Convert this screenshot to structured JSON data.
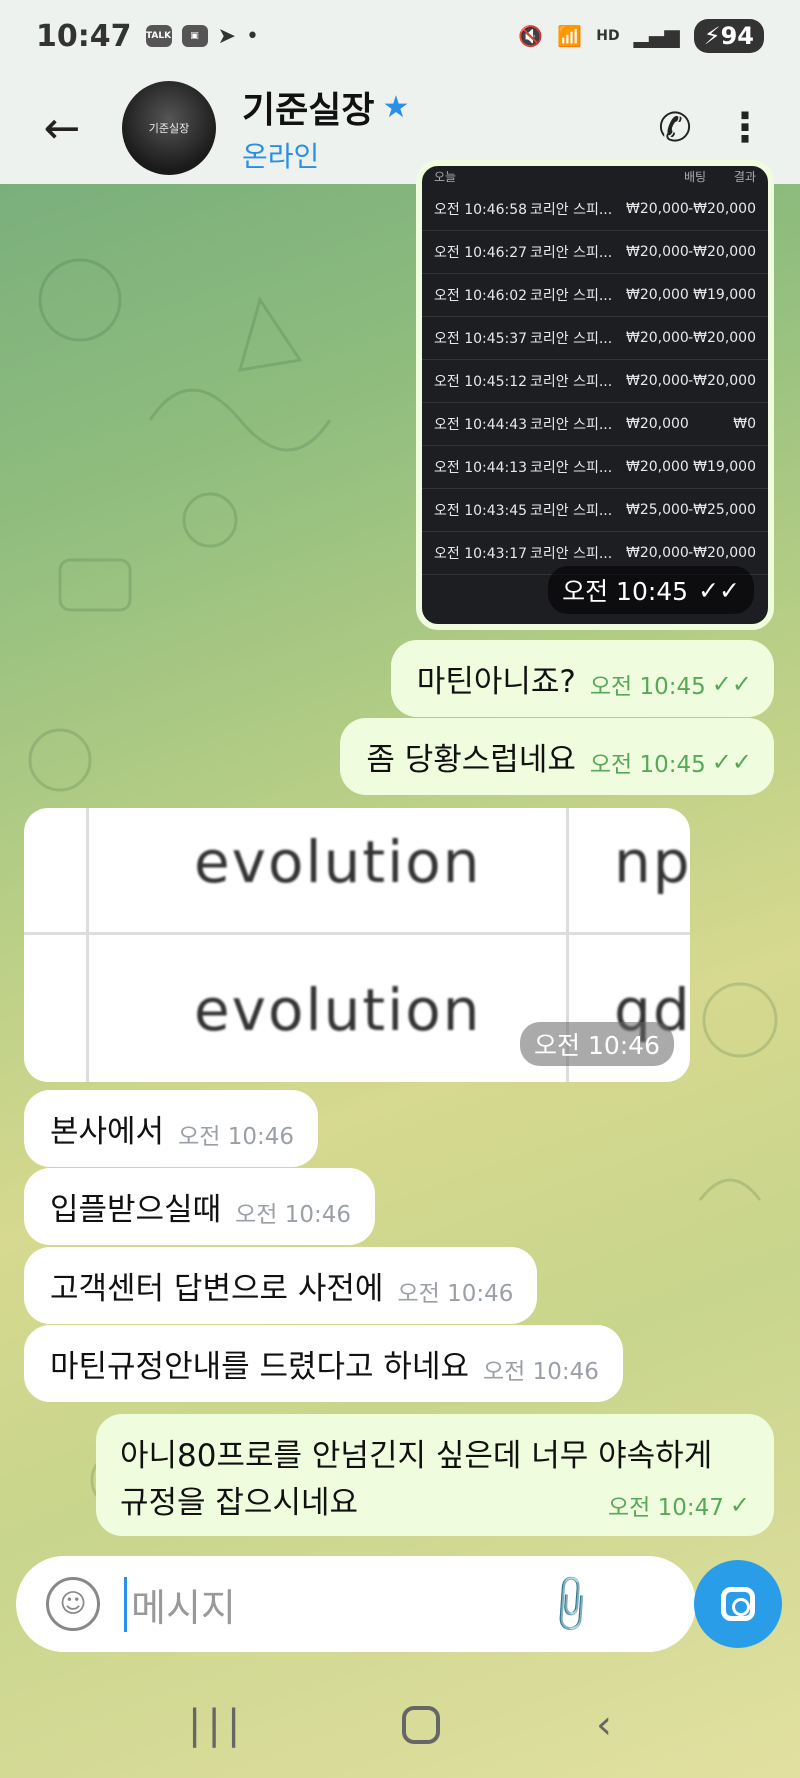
{
  "status_bar": {
    "time": "10:47",
    "icons": [
      "talk-icon",
      "screenshot-icon",
      "telegram-icon",
      "dot-icon"
    ],
    "talk_label": "TALK",
    "hd_label": "HD",
    "battery": "94"
  },
  "header": {
    "title": "기준실장",
    "status": "온라인",
    "avatar_text": "기준실장"
  },
  "bet_table": {
    "headers": [
      "오늘",
      "배팅",
      "결과"
    ],
    "rows": [
      {
        "time": "오전 10:46:58",
        "game": "코리안 스피...",
        "bet": "₩20,000",
        "result": "-₩20,000"
      },
      {
        "time": "오전 10:46:27",
        "game": "코리안 스피...",
        "bet": "₩20,000",
        "result": "-₩20,000"
      },
      {
        "time": "오전 10:46:02",
        "game": "코리안 스피...",
        "bet": "₩20,000",
        "result": "₩19,000"
      },
      {
        "time": "오전 10:45:37",
        "game": "코리안 스피...",
        "bet": "₩20,000",
        "result": "-₩20,000"
      },
      {
        "time": "오전 10:45:12",
        "game": "코리안 스피...",
        "bet": "₩20,000",
        "result": "-₩20,000"
      },
      {
        "time": "오전 10:44:43",
        "game": "코리안 스피...",
        "bet": "₩20,000",
        "result": "₩0"
      },
      {
        "time": "오전 10:44:13",
        "game": "코리안 스피...",
        "bet": "₩20,000",
        "result": "₩19,000"
      },
      {
        "time": "오전 10:43:45",
        "game": "코리안 스피...",
        "bet": "₩25,000",
        "result": "-₩25,000"
      },
      {
        "time": "오전 10:43:17",
        "game": "코리안 스피...",
        "bet": "₩20,000",
        "result": "-₩20,000"
      }
    ],
    "timestamp": "오전 10:45"
  },
  "messages": {
    "m1": {
      "text": "마틴아니죠?",
      "time": "오전 10:45"
    },
    "m2": {
      "text": "좀 당황스럽네요",
      "time": "오전 10:45"
    },
    "evo": {
      "cell1": "evolution",
      "cell2": "np",
      "cell3": "evolution",
      "cell4": "qd",
      "time": "오전 10:46"
    },
    "m3": {
      "text": "본사에서",
      "time": "오전 10:46"
    },
    "m4": {
      "text": "입플받으실때",
      "time": "오전 10:46"
    },
    "m5": {
      "text": "고객센터 답변으로 사전에",
      "time": "오전 10:46"
    },
    "m6": {
      "text": "마틴규정안내를 드렸다고 하네요",
      "time": "오전 10:46"
    },
    "m7": {
      "line1": "아니80프로를 안넘긴지 싶은데 너무 야속하게",
      "line2": "규정을 잡으시네요",
      "time": "오전 10:47"
    }
  },
  "composer": {
    "placeholder": "메시지"
  },
  "colors": {
    "accent": "#2a8fe8",
    "out_bubble": "#effdde",
    "check_green": "#59a85a"
  }
}
